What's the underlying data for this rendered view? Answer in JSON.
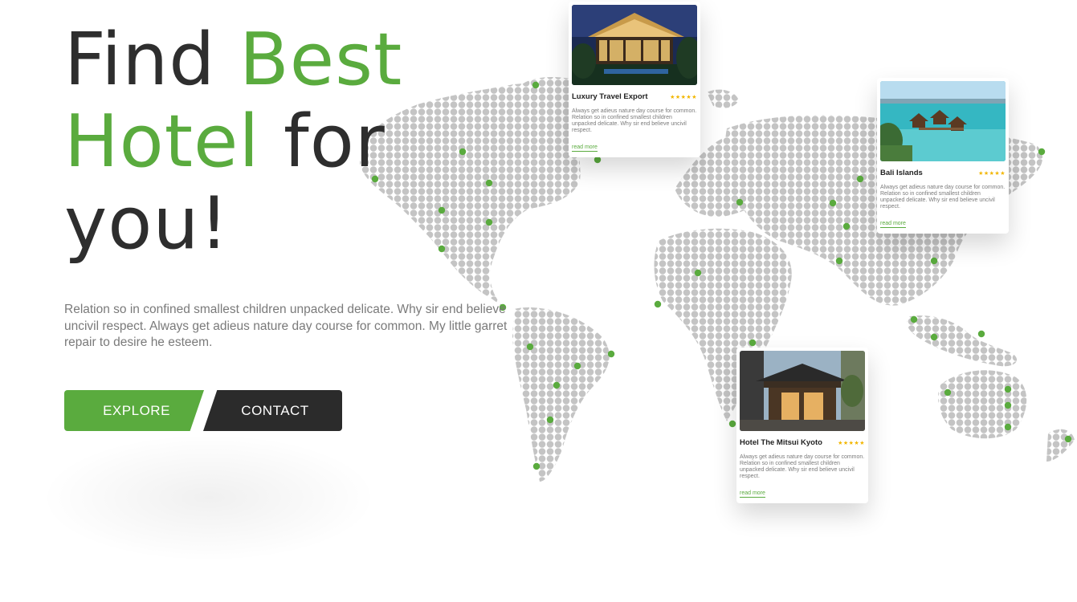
{
  "hero": {
    "title_line1_dark": "Find",
    "title_line1_accent": "Best",
    "title_line2_accent": "Hotel",
    "title_line2_dark": "for",
    "title_line3_dark": "you!",
    "description": "Relation so in confined smallest children unpacked delicate. Why sir end believe uncivil respect. Always get adieus nature day course for common. My little garret repair to desire he esteem."
  },
  "buttons": {
    "explore": "EXPLORE",
    "contact": "CONTACT"
  },
  "cards": [
    {
      "title": "Luxury Travel Export",
      "stars": "★★★★★",
      "text": "Always get adieus nature day course for common. Relation so in confined smallest children unpacked delicate. Why sir end believe uncivil respect.",
      "link": "read more",
      "image": "night-resort-photo"
    },
    {
      "title": "Bali Islands",
      "stars": "★★★★★",
      "text": "Always get adieus nature day course for common. Relation so in confined smallest children unpacked delicate. Why sir end believe uncivil respect.",
      "link": "read more",
      "image": "overwater-bungalows-photo"
    },
    {
      "title": "Hotel The Mitsui Kyoto",
      "stars": "★★★★★",
      "text": "Always get adieus nature day course for common. Relation so in confined smallest children unpacked delicate. Why sir end believe uncivil respect.",
      "link": "read more",
      "image": "kyoto-gate-photo"
    }
  ],
  "colors": {
    "accent": "#5aab3e",
    "dark": "#2e2e2e",
    "map_dot": "#c4c4c4",
    "stars": "#f2b600"
  }
}
